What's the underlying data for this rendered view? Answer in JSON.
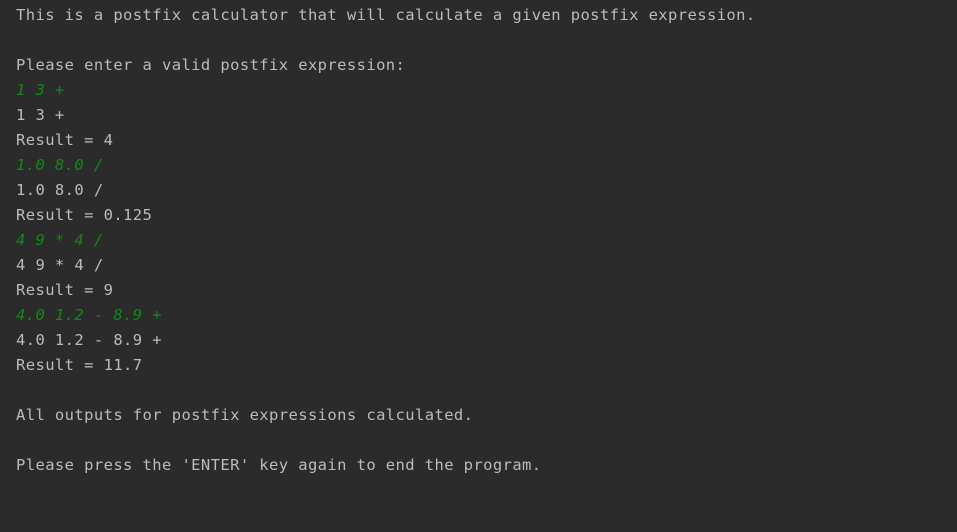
{
  "console": {
    "intro": "This is a postfix calculator that will calculate a given postfix expression.",
    "prompt": "Please enter a valid postfix expression:",
    "entries": [
      {
        "input": "1 3 +",
        "echo": "1 3 +",
        "result": "Result = 4"
      },
      {
        "input": "1.0 8.0 /",
        "echo": "1.0 8.0 /",
        "result": "Result = 0.125"
      },
      {
        "input": "4 9 * 4 /",
        "echo": "4 9 * 4 /",
        "result": "Result = 9"
      },
      {
        "input": "4.0 1.2 - 8.9 +",
        "echo": "4.0 1.2 - 8.9 +",
        "result": "Result = 11.7"
      }
    ],
    "done": "All outputs for postfix expressions calculated.",
    "exit_prompt": "Please press the 'ENTER' key again to end the program."
  },
  "colors": {
    "background": "#2b2b2b",
    "output_text": "#bbbbbb",
    "user_input_text": "#0e8a16"
  }
}
